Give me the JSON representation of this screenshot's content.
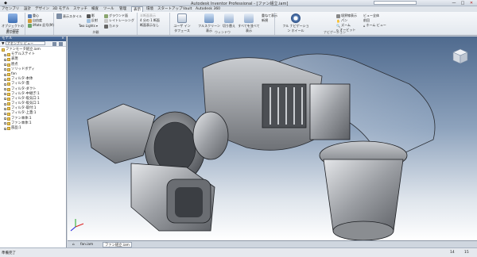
{
  "window": {
    "title": "Autodesk Inventor Professional - [ファン組立.iam]",
    "controls": [
      "—",
      "□",
      "✕"
    ]
  },
  "menu_tabs": [
    {
      "label": "アセンブリ",
      "active": false
    },
    {
      "label": "設計",
      "active": false
    },
    {
      "label": "デザイン",
      "active": false
    },
    {
      "label": "3D モデル",
      "active": false
    },
    {
      "label": "スケッチ",
      "active": false
    },
    {
      "label": "検査",
      "active": false
    },
    {
      "label": "ツール",
      "active": false
    },
    {
      "label": "管理",
      "active": false
    },
    {
      "label": "表示",
      "active": true
    },
    {
      "label": "環境",
      "active": false
    },
    {
      "label": "スタートアップ",
      "active": false
    },
    {
      "label": "Vault",
      "active": false
    },
    {
      "label": "Autodesk 360",
      "active": false
    }
  ],
  "ribbon": {
    "groups": [
      {
        "label": "表示設定",
        "items": [
          "オブジェクトの表示設定"
        ]
      },
      {
        "label": "",
        "items": [
          "重心",
          "自由度",
          "iMate 記号(M)"
        ]
      },
      {
        "label": "外観",
        "items": [
          "表示スタイル",
          "影",
          "反射",
          "Two Lights",
          "グラウンド面",
          "レイトレーシング",
          "カメラ"
        ]
      },
      {
        "label": "",
        "items": [
          "半断面表示",
          "4 分の 1 断面",
          "断面表示なし"
        ]
      },
      {
        "label": "ウィンドウ",
        "items": [
          "ユーザ インタフェース",
          "フルスクリーン表示",
          "切り替え",
          "すべてを並べて表示",
          "重ねて表示",
          "新規"
        ]
      },
      {
        "label": "ナビゲーション",
        "items": [
          "フル ナビゲーション ホイール",
          "境界線表示",
          "パン",
          "ズーム",
          "オービット",
          "ビュー全体",
          "前回",
          "ホーム ビュー"
        ]
      }
    ]
  },
  "browser": {
    "title": "モデル",
    "dropdown": "アセンブリ ビュー",
    "items": [
      "ファンモータ組立.iam",
      "モデルステイト",
      "表現",
      "原点",
      "ソリッドボディ",
      "fan",
      "フィルタ-本体",
      "フィルタ-蓋",
      "フィルタ-ダクト",
      "フィルタ-中継ぎ:1",
      "フィルタ-吸気口:1",
      "フィルタ-吸気口:1",
      "フィルタ-取付:1",
      "フィルタ-上蓋:1",
      "ファン本体:1",
      "ファン本体:1",
      "部品:1"
    ]
  },
  "doc_tabs": [
    {
      "label": "fan.iam",
      "active": false
    },
    {
      "label": "ファン組立.iam",
      "active": true
    }
  ],
  "status": {
    "message": "準備完了",
    "count_a": "14",
    "count_b": "15"
  },
  "colors": {
    "viewport_top": "#4f6a8e",
    "viewport_bottom": "#ffffff",
    "browser_header": "#3a5a87",
    "part_gray": "#8a8d91"
  }
}
